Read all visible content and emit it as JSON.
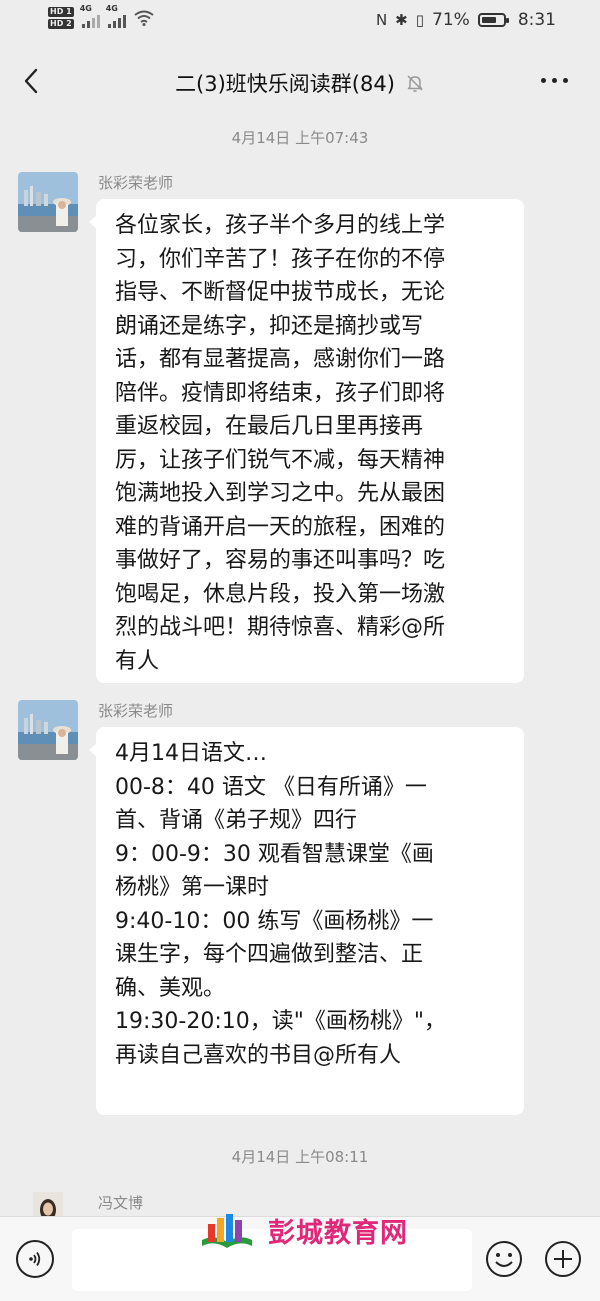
{
  "status_bar": {
    "hd1": "HD 1",
    "hd2": "HD 2",
    "net1": "4G",
    "net2": "4G",
    "nfc": "N",
    "bt": "✱",
    "vibrate": "▯",
    "battery_percent": "71%",
    "battery_level": 71,
    "time": "8:31"
  },
  "header": {
    "title": "二(3)班快乐阅读群(84)"
  },
  "chat": {
    "timestamps": [
      "4月14日 上午07:43",
      "4月14日 上午08:11"
    ],
    "messages": [
      {
        "sender": "张彩荣老师",
        "text": "各位家长，孩子半个多月的线上学\n习，你们辛苦了！孩子在你的不停\n指导、不断督促中拔节成长，无论\n朗诵还是练字，抑还是摘抄或写\n话，都有显著提高，感谢你们一路\n陪伴。疫情即将结束，孩子们即将\n重返校园，在最后几日里再接再\n厉，让孩子们锐气不减，每天精神\n饱满地投入到学习之中。先从最困\n难的背诵开启一天的旅程，困难的\n事做好了，容易的事还叫事吗？吃\n饱喝足，休息片段，投入第一场激\n烈的战斗吧！期待惊喜、精彩@所\n有人"
      },
      {
        "sender": "张彩荣老师",
        "text": "4月14日语文…\n00-8：40 语文 《日有所诵》一\n首、背诵《弟子规》四行\n9：00-9：30 观看智慧课堂《画\n杨桃》第一课时\n9:40-10：00 练写《画杨桃》一\n课生字，每个四遍做到整洁、正\n确、美观。\n19:30-20:10，读\"《画杨桃》\"，\n再读自己喜欢的书目@所有人"
      },
      {
        "sender": "冯文博"
      }
    ]
  },
  "watermark": {
    "text": "彭城教育网"
  },
  "icons": {
    "back": "back-arrow-icon",
    "mute": "mute-bell-icon",
    "more": "more-icon",
    "voice": "voice-icon",
    "emoji": "emoji-icon",
    "plus": "plus-icon"
  }
}
